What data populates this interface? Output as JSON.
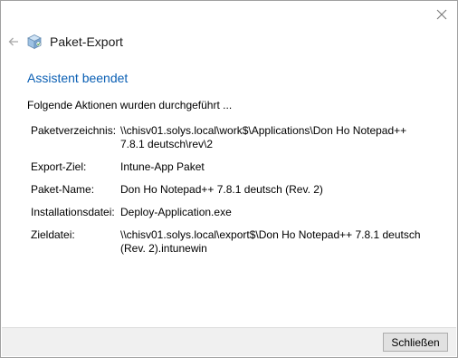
{
  "window": {
    "title": "Paket-Export"
  },
  "heading": "Assistent beendet",
  "subtitle": "Folgende Aktionen wurden durchgeführt ...",
  "details": [
    {
      "label": "Paketverzeichnis:",
      "value": "\\\\chisv01.solys.local\\work$\\Applications\\Don Ho Notepad++\n7.8.1 deutsch\\rev\\2"
    },
    {
      "label": "Export-Ziel:",
      "value": "Intune-App Paket"
    },
    {
      "label": "Paket-Name:",
      "value": "Don Ho Notepad++ 7.8.1 deutsch (Rev. 2)"
    },
    {
      "label": "Installationsdatei:",
      "value": "Deploy-Application.exe"
    },
    {
      "label": "Zieldatei:",
      "value": "\\\\chisv01.solys.local\\export$\\Don Ho Notepad++ 7.8.1 deutsch\n(Rev. 2).intunewin"
    }
  ],
  "footer": {
    "close_label": "Schließen"
  },
  "icons": {
    "close": "close-icon",
    "back": "back-arrow-icon",
    "app": "package-icon"
  },
  "colors": {
    "heading": "#0a5fb4",
    "footer_bg": "#f0f0f0"
  }
}
